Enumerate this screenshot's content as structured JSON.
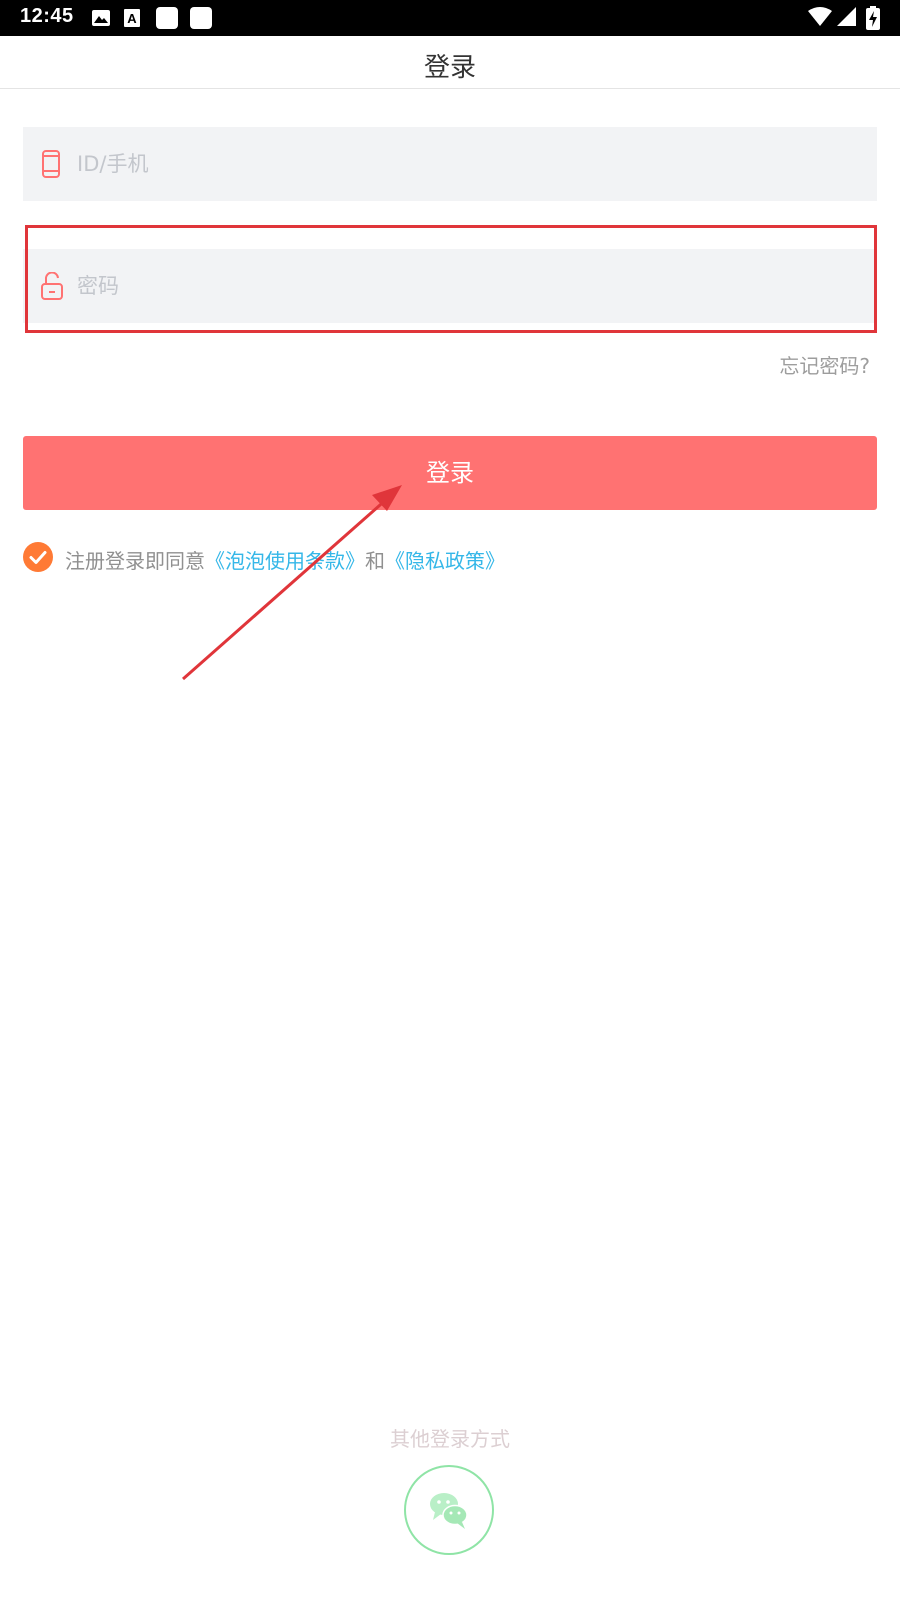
{
  "status_bar": {
    "time": "12:45",
    "left_icons": [
      "image-icon",
      "keyboard-a-icon",
      "notification-square-icon",
      "notification-square-icon"
    ],
    "right_icons": [
      "wifi-icon",
      "signal-icon",
      "battery-charging-icon"
    ]
  },
  "nav": {
    "title": "登录"
  },
  "form": {
    "account_placeholder": "ID/手机",
    "password_placeholder": "密码",
    "forgot_label": "忘记密码?",
    "login_label": "登录"
  },
  "agreement": {
    "checked": true,
    "prefix": "注册登录即同意",
    "terms_link": "《泡泡使用条款》",
    "joiner": "和",
    "privacy_link": "《隐私政策》"
  },
  "other_login": {
    "label": "其他登录方式",
    "icon": "wechat-icon"
  },
  "colors": {
    "accent": "#ff7272",
    "checkbox": "#ff7a35",
    "link": "#35b7e8",
    "wechat": "#8fe4a6",
    "annotation": "#e0353a"
  }
}
